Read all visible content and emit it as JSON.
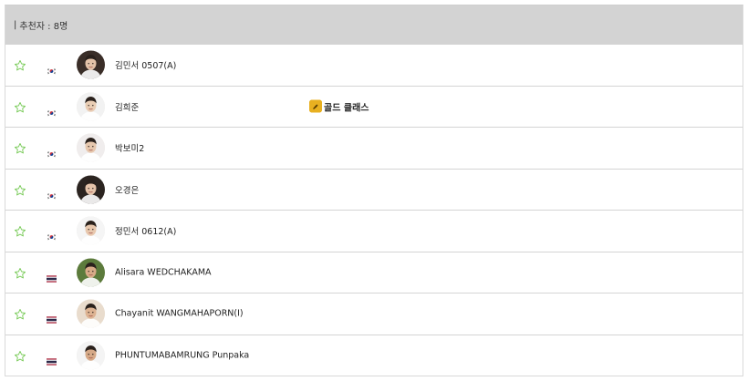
{
  "header": {
    "title": "추천자 : 8명"
  },
  "players": [
    {
      "name": "김민서 0507(A)",
      "country": "KOR",
      "flag_icon": "korea-flag-icon",
      "avatar_bg": "#3a2e28",
      "skin": "#e3c2a8"
    },
    {
      "name": "김희준",
      "country": "KOR",
      "flag_icon": "korea-flag-icon",
      "avatar_bg": "#f2f2f2",
      "skin": "#e9cdb4",
      "badge": "골드 클래스",
      "badge_icon": "gold-class-icon"
    },
    {
      "name": "박보미2",
      "country": "KOR",
      "flag_icon": "korea-flag-icon",
      "avatar_bg": "#f0eded",
      "skin": "#e6c7ad"
    },
    {
      "name": "오경은",
      "country": "KOR",
      "flag_icon": "korea-flag-icon",
      "avatar_bg": "#2b2420",
      "skin": "#e6c4aa"
    },
    {
      "name": "정민서 0612(A)",
      "country": "KOR",
      "flag_icon": "korea-flag-icon",
      "avatar_bg": "#f5f5f5",
      "skin": "#e8c8ae"
    },
    {
      "name": "Alisara WEDCHAKAMA",
      "country": "THA",
      "flag_icon": "thailand-flag-icon",
      "avatar_bg": "#5c7b3c",
      "skin": "#d8ab88"
    },
    {
      "name": "Chayanit WANGMAHAPORN(I)",
      "country": "THA",
      "flag_icon": "thailand-flag-icon",
      "avatar_bg": "#e9dccd",
      "skin": "#ddb392"
    },
    {
      "name": "PHUNTUMABAMRUNG Punpaka",
      "country": "THA",
      "flag_icon": "thailand-flag-icon",
      "avatar_bg": "#f4f4f4",
      "skin": "#d6a987"
    }
  ],
  "colors": {
    "star": "#7acb5a",
    "header_bg": "#d3d3d3",
    "row_border": "#d4d4d4",
    "badge_gold": "#e8b020"
  }
}
